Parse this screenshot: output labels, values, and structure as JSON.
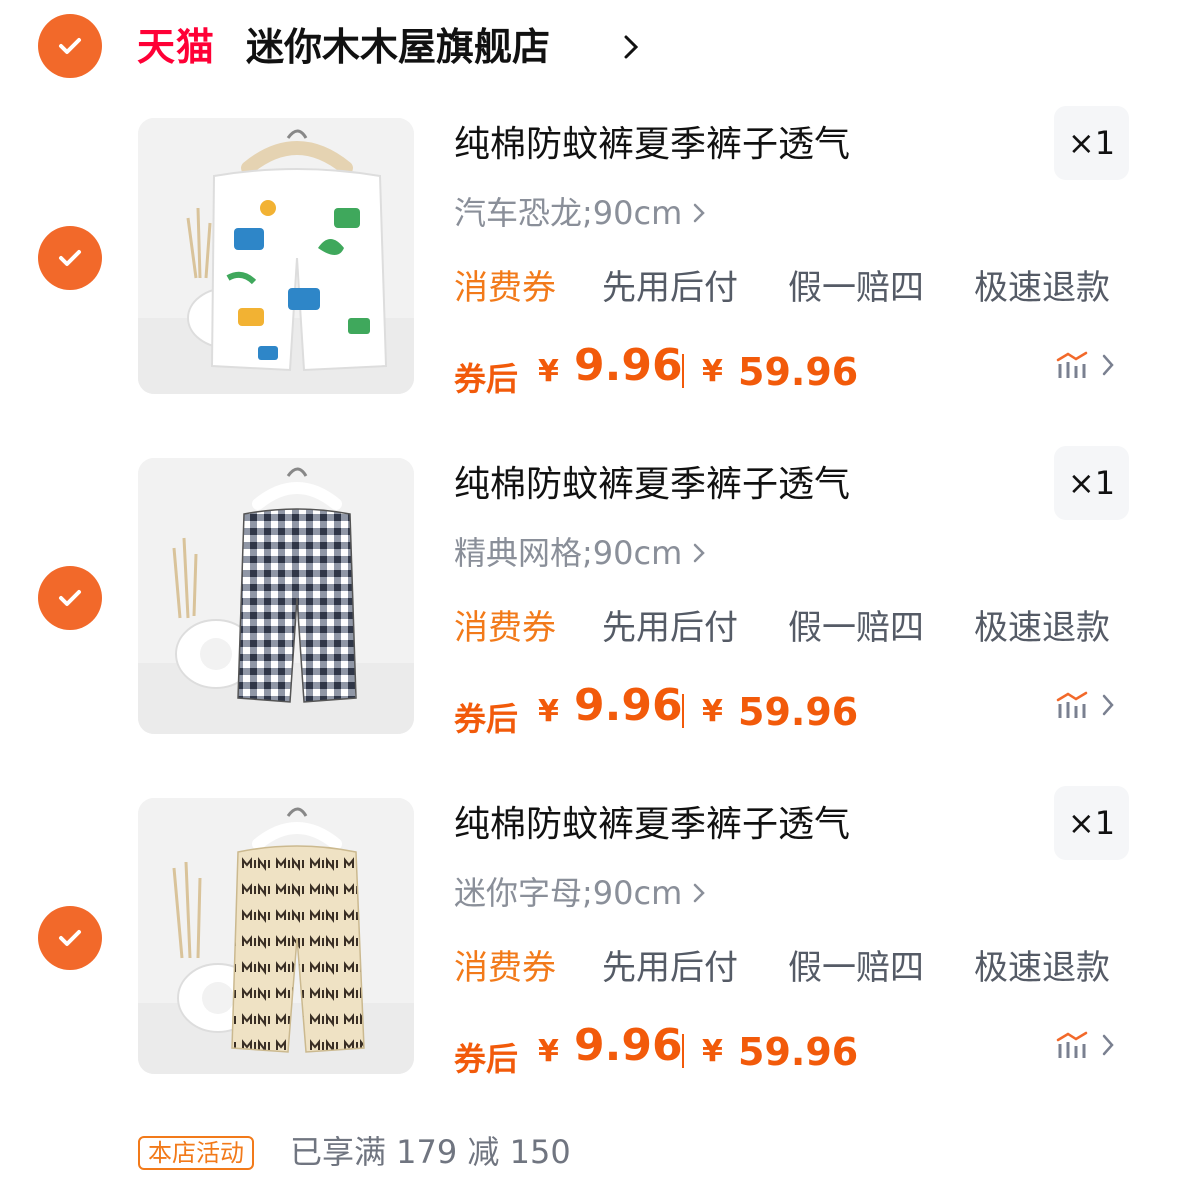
{
  "shop": {
    "platform_logo": "天猫",
    "name": "迷你木木屋旗舰店",
    "selected": true
  },
  "colors": {
    "accent_orange": "#f2692a",
    "price_orange": "#f25a0a",
    "tmall_red": "#ff0036",
    "muted_grey": "#8a8f99"
  },
  "items": [
    {
      "selected": true,
      "title": "纯棉防蚊裤夏季裤子透气",
      "quantity": "×1",
      "sku": "汽车恐龙;90cm",
      "tags": [
        "消费券",
        "先用后付",
        "假一赔四",
        "极速退款"
      ],
      "price_label": "券后",
      "currency": "¥",
      "coupon_price": "9.96",
      "original_price": "59.96",
      "image": "white pants with car and dinosaur print on hanger"
    },
    {
      "selected": true,
      "title": "纯棉防蚊裤夏季裤子透气",
      "quantity": "×1",
      "sku": "精典网格;90cm",
      "tags": [
        "消费券",
        "先用后付",
        "假一赔四",
        "极速退款"
      ],
      "price_label": "券后",
      "currency": "¥",
      "coupon_price": "9.96",
      "original_price": "59.96",
      "image": "navy gingham check pants on hanger"
    },
    {
      "selected": true,
      "title": "纯棉防蚊裤夏季裤子透气",
      "quantity": "×1",
      "sku": "迷你字母;90cm",
      "tags": [
        "消费券",
        "先用后付",
        "假一赔四",
        "极速退款"
      ],
      "price_label": "券后",
      "currency": "¥",
      "coupon_price": "9.96",
      "original_price": "59.96",
      "image": "beige pants with MINI letter print on hanger"
    }
  ],
  "footer": {
    "promo_badge": "本店活动",
    "promo_text": "已享满 179 减 150"
  }
}
